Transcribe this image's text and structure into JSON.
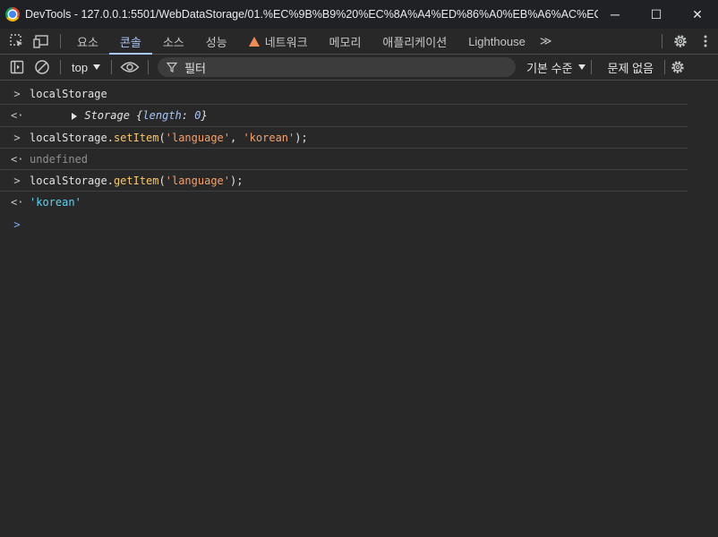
{
  "window": {
    "title": "DevTools - 127.0.0.1:5501/WebDataStorage/01.%EC%9B%B9%20%EC%8A%A4%ED%86%A0%EB%A6%AC%EC%A7%...",
    "minimize": "─",
    "maximize": "☐",
    "close": "✕"
  },
  "tabs": [
    {
      "label": "요소"
    },
    {
      "label": "콘솔"
    },
    {
      "label": "소스"
    },
    {
      "label": "성능"
    },
    {
      "label": "네트워크"
    },
    {
      "label": "메모리"
    },
    {
      "label": "애플리케이션"
    },
    {
      "label": "Lighthouse"
    }
  ],
  "more_tabs": "≫",
  "console_toolbar": {
    "context": "top",
    "filter_placeholder": "필터",
    "levels": "기본 수준",
    "issues": "문제 없음"
  },
  "console": {
    "entries": [
      {
        "type": "input",
        "parts": [
          "localStorage"
        ]
      },
      {
        "type": "output",
        "storage_label": "Storage",
        "open_brace": " {",
        "key": "length",
        "colon": ": ",
        "value": "0",
        "close_brace": "}"
      },
      {
        "type": "input",
        "object": "localStorage",
        "dot": ".",
        "method": "setItem",
        "open": "(",
        "arg1": "'language'",
        "comma": ", ",
        "arg2": "'korean'",
        "close": ");"
      },
      {
        "type": "output",
        "text": "undefined"
      },
      {
        "type": "input",
        "object": "localStorage",
        "dot": ".",
        "method": "getItem",
        "open": "(",
        "arg1": "'language'",
        "close": ");"
      },
      {
        "type": "output",
        "text": "'korean'"
      }
    ],
    "input_glyph": ">",
    "output_glyph": "<·",
    "prompt_glyph": ">"
  },
  "colors": {
    "active_tab": "#a8c7fa",
    "method": "#f6c86b",
    "string": "#f6a068",
    "result_string": "#5cd5f0",
    "warning": "#f28b54"
  }
}
